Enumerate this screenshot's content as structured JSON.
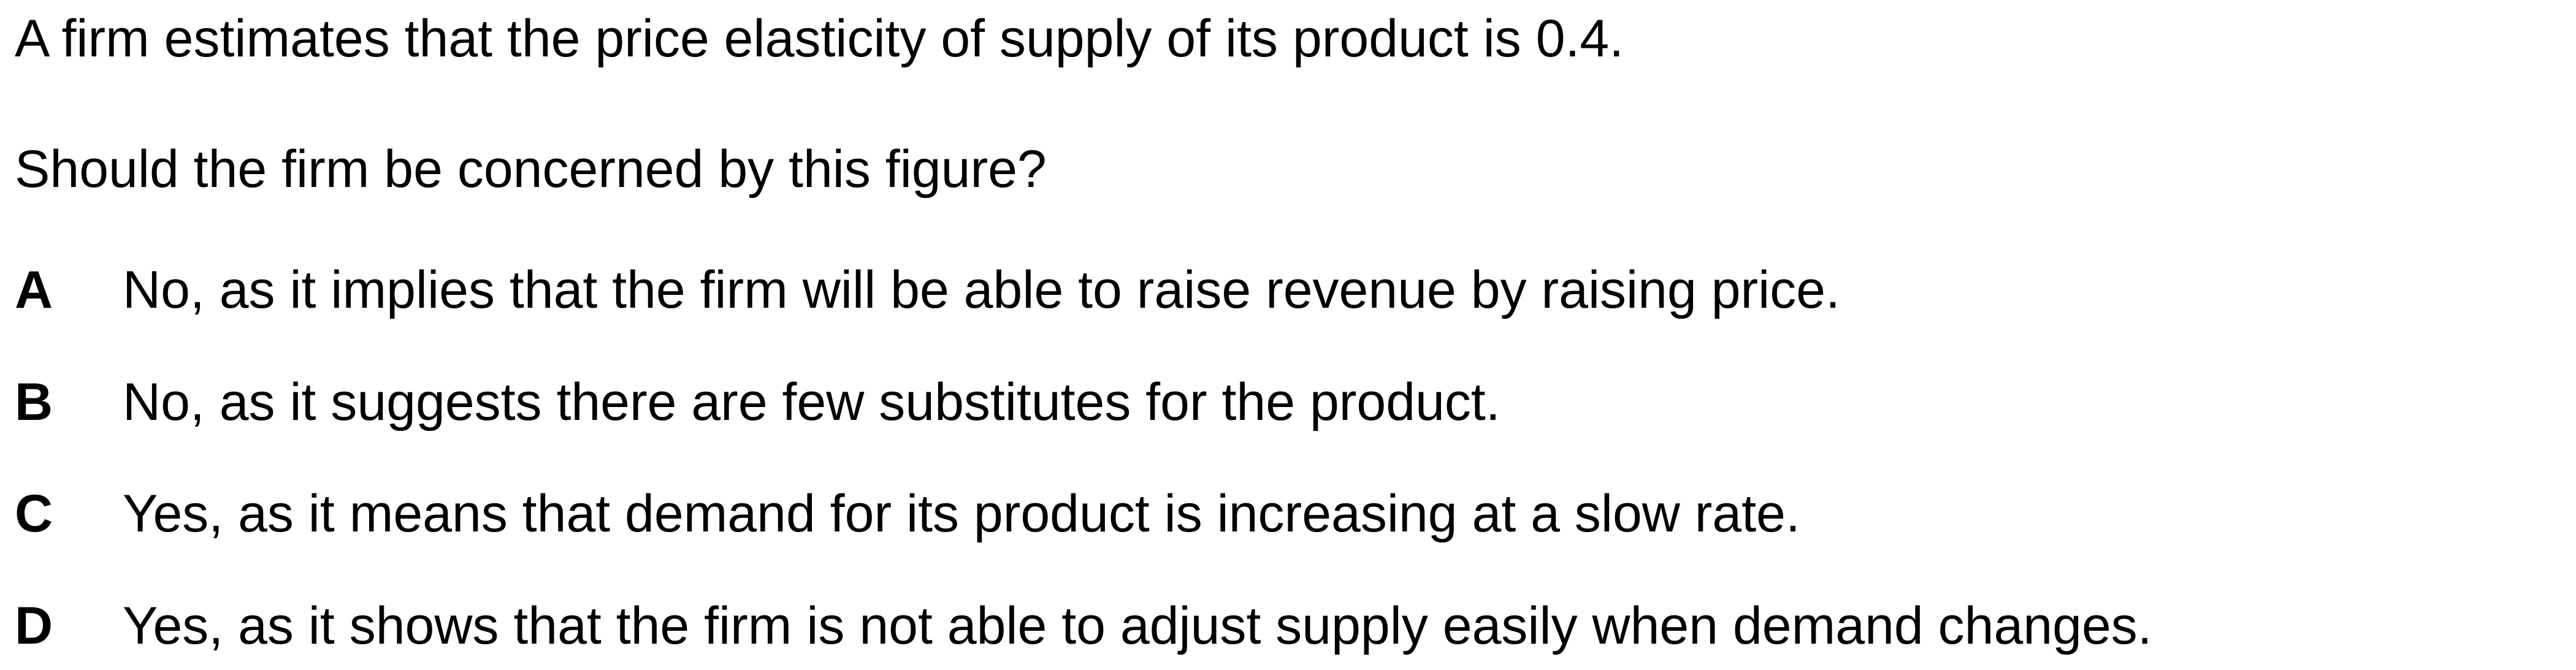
{
  "question": {
    "stem_line_1": "A firm estimates that the price elasticity of supply of its product is 0.4.",
    "stem_line_2": "Should the firm be concerned by this figure?"
  },
  "options": [
    {
      "letter": "A",
      "text": "No, as it implies that the firm will be able to raise revenue by raising price."
    },
    {
      "letter": "B",
      "text": "No, as it suggests there are few substitutes for the product."
    },
    {
      "letter": "C",
      "text": "Yes, as it means that demand for its product is increasing at a slow rate."
    },
    {
      "letter": "D",
      "text": "Yes, as it shows that the firm is not able to adjust supply easily when demand changes."
    }
  ]
}
